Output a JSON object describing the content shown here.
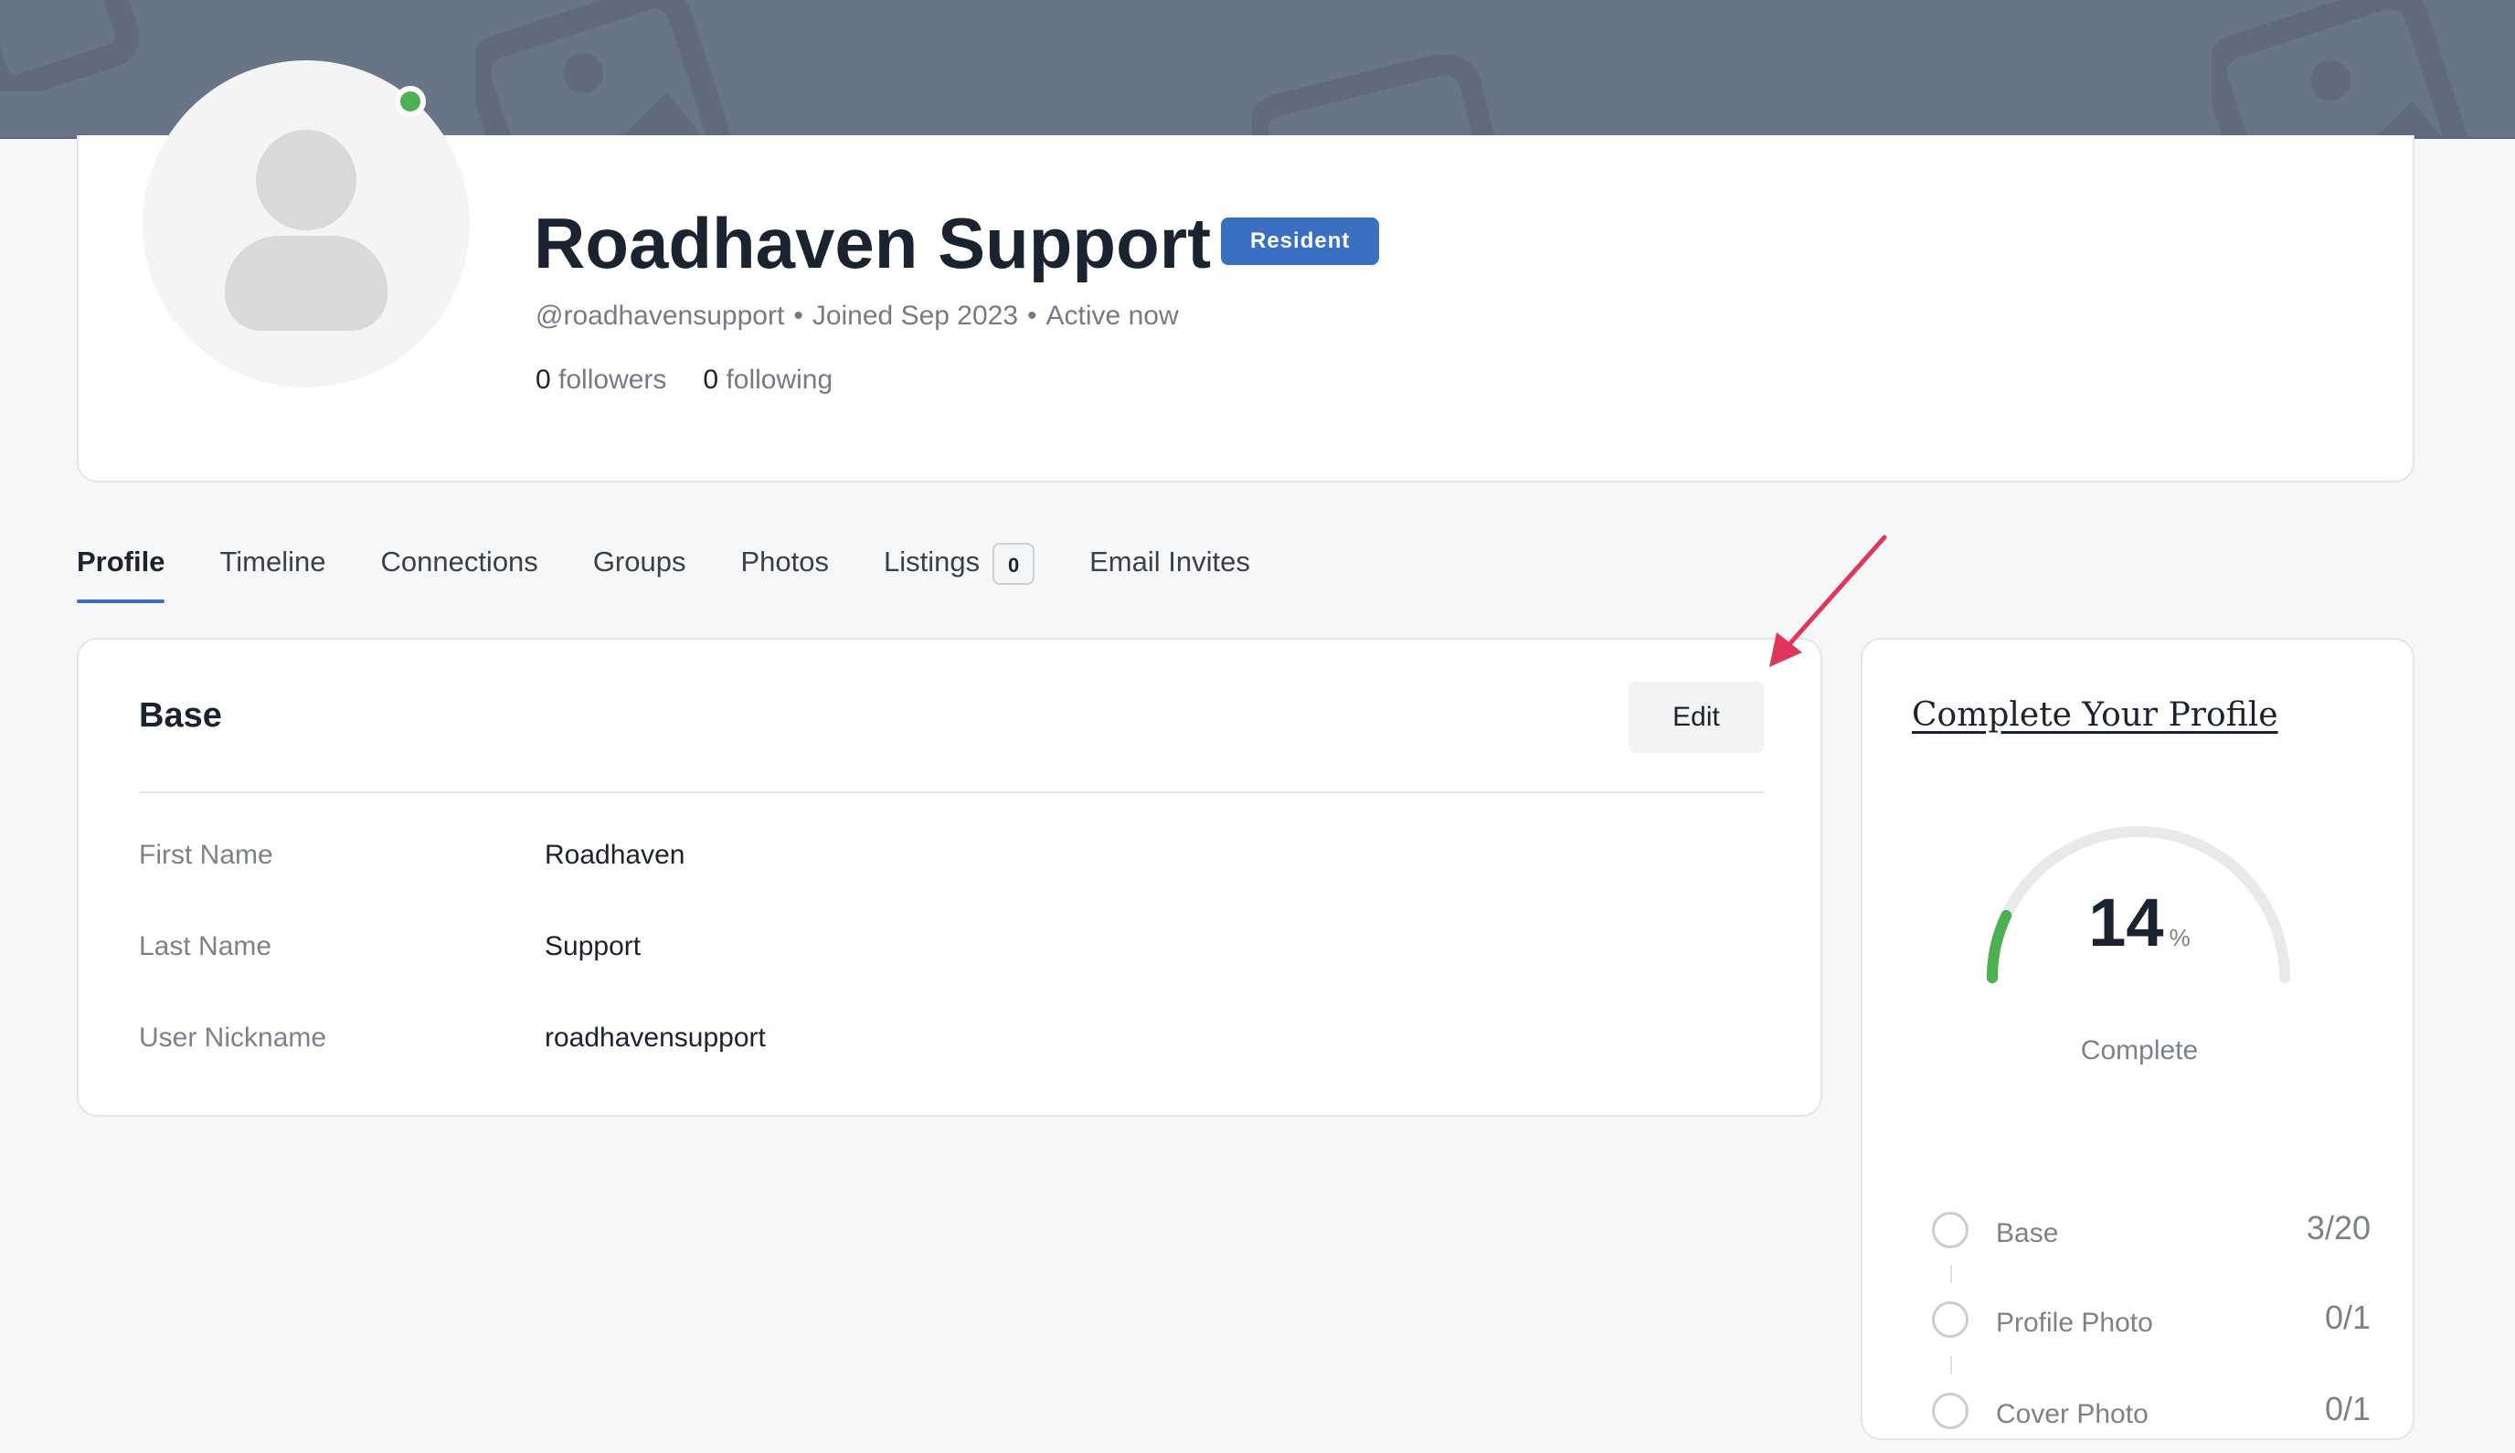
{
  "profile": {
    "name": "Roadhaven Support",
    "role_badge": "Resident",
    "handle": "@roadhavensupport",
    "joined": "Joined Sep 2023",
    "activity": "Active now",
    "followers_count": "0",
    "followers_label": "followers",
    "following_count": "0",
    "following_label": "following",
    "online": true
  },
  "tabs": [
    {
      "label": "Profile",
      "active": true
    },
    {
      "label": "Timeline"
    },
    {
      "label": "Connections"
    },
    {
      "label": "Groups"
    },
    {
      "label": "Photos"
    },
    {
      "label": "Listings",
      "count": "0"
    },
    {
      "label": "Email Invites"
    }
  ],
  "base_section": {
    "title": "Base",
    "edit_label": "Edit",
    "fields": [
      {
        "label": "First Name",
        "value": "Roadhaven"
      },
      {
        "label": "Last Name",
        "value": "Support"
      },
      {
        "label": "User Nickname",
        "value": "roadhavensupport"
      }
    ]
  },
  "completion": {
    "title": "Complete Your Profile",
    "percent": 14,
    "percent_text": "14",
    "unit": "%",
    "label": "Complete",
    "steps": [
      {
        "label": "Base",
        "count": "3/20"
      },
      {
        "label": "Profile Photo",
        "count": "0/1"
      },
      {
        "label": "Cover Photo",
        "count": "0/1"
      }
    ]
  },
  "colors": {
    "accent": "#3a6fc2",
    "online": "#4caf50",
    "progress": "#4caf50",
    "annotation": "#e0365a",
    "cover": "#687586"
  }
}
